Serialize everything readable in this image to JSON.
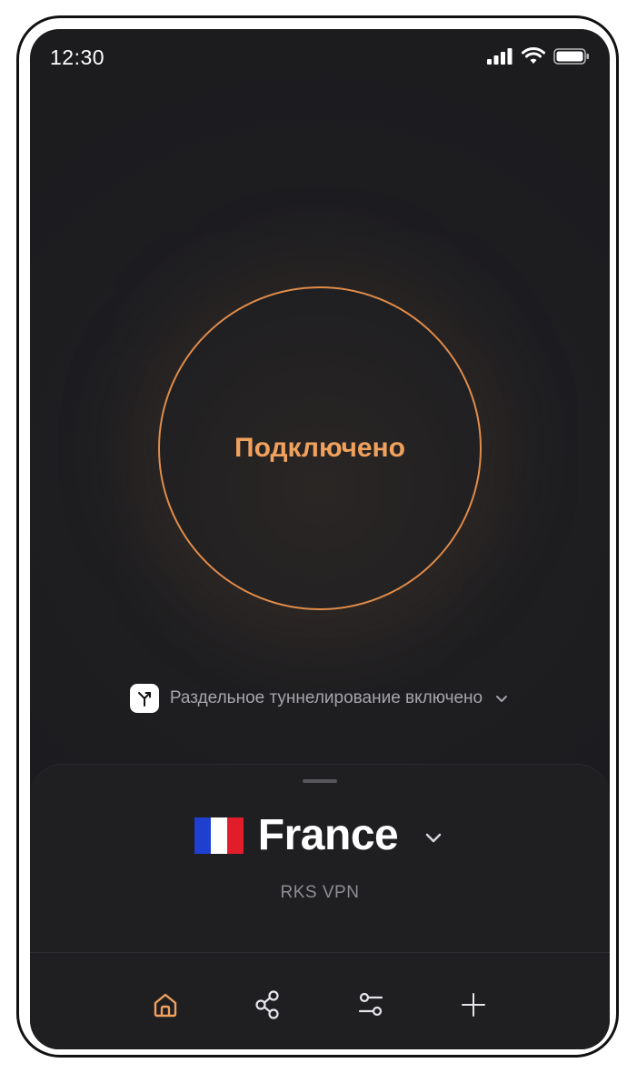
{
  "status_bar": {
    "time": "12:30",
    "icons": [
      "signal-icon",
      "wifi-icon",
      "battery-icon"
    ]
  },
  "connection": {
    "status_label": "Подключено",
    "accent_color": "#f0a15d"
  },
  "split_tunneling": {
    "label": "Раздельное туннелирование включено"
  },
  "location": {
    "country": "France",
    "provider": "RKS VPN",
    "flag_colors": [
      "#1f3fd1",
      "#ffffff",
      "#e11d2b"
    ]
  },
  "nav": {
    "items": [
      "home-icon",
      "share-icon",
      "settings-sliders-icon",
      "add-icon"
    ],
    "active": "home-icon"
  }
}
